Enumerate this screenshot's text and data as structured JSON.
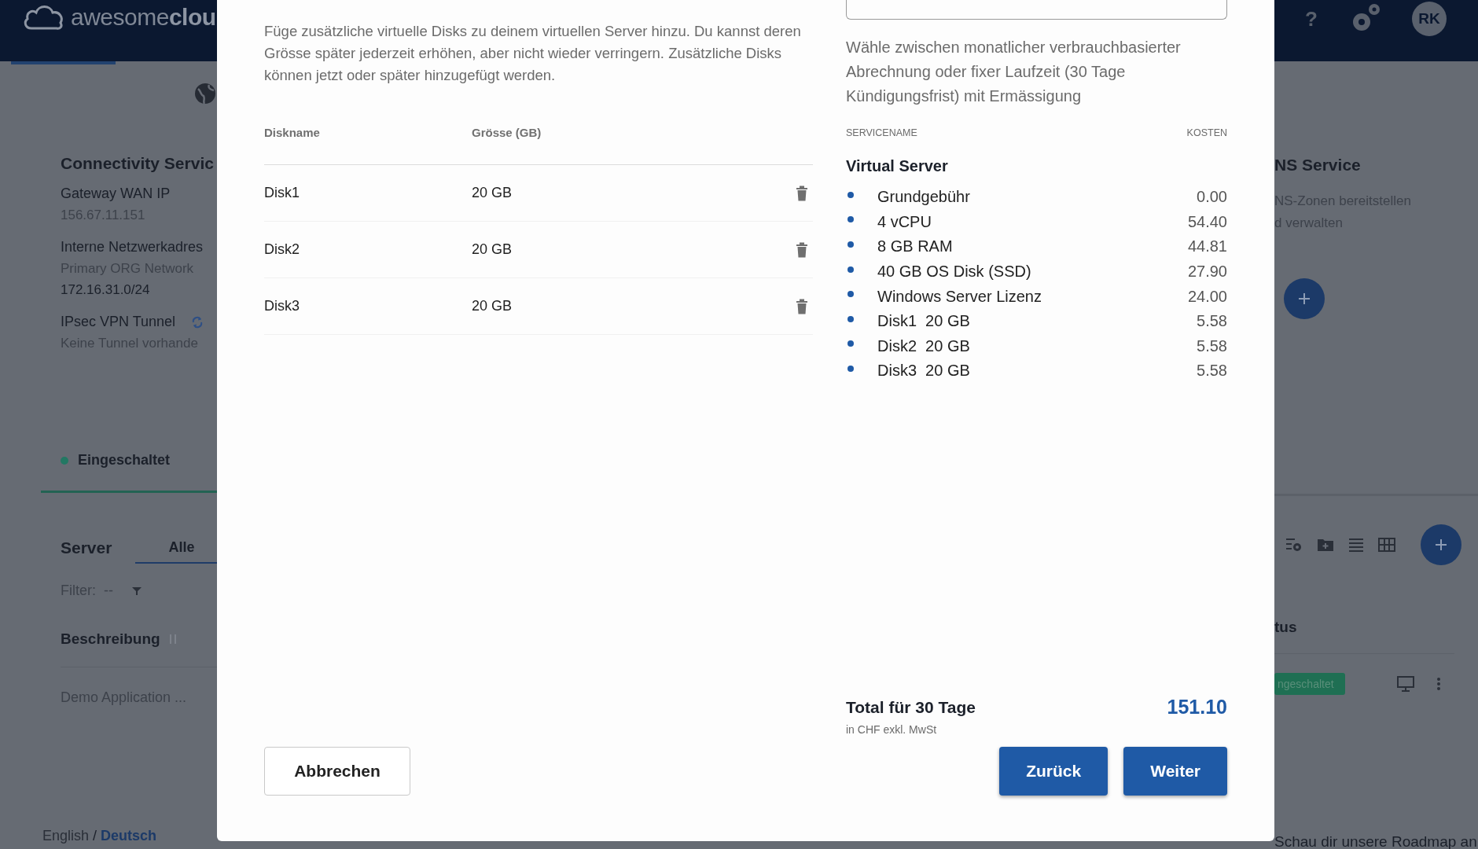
{
  "app_header": {
    "logo_text": "awesome**clou**",
    "help_label": "?",
    "avatar_initials": "RK"
  },
  "left_panel": {
    "connectivity_card": {
      "title": "Connectivity Servic",
      "fields": [
        {
          "label": "Gateway WAN IP",
          "kind": "plain",
          "lines": [
            {
              "text": "156.67.11.151",
              "kind": "muted"
            }
          ]
        },
        {
          "label": "Interne Netzwerkadres",
          "kind": "plain",
          "lines": [
            {
              "text": "Primary ORG Network",
              "kind": "muted"
            },
            {
              "text": "172.16.31.0/24",
              "kind": "strong"
            }
          ]
        },
        {
          "label": "IPsec VPN Tunnel",
          "kind": "sync",
          "lines": [
            {
              "text": "Keine Tunnel vorhande",
              "kind": "muted"
            }
          ]
        }
      ],
      "status": "Eingeschaltet"
    },
    "server_card": {
      "title": "Server",
      "tabs": [
        {
          "label": "Alle",
          "selected": true
        }
      ],
      "filter_label": "Filter:",
      "filter_value": "--",
      "column_header": "Beschreibung",
      "rows": [
        {
          "description": "Demo Application ..."
        }
      ]
    },
    "languages": [
      {
        "label": "English",
        "selected": false
      },
      {
        "label": "Deutsch",
        "selected": true
      }
    ],
    "language_separator": "/"
  },
  "right_panel": {
    "dns_card": {
      "title": "NS Service",
      "description_lines": [
        "NS-Zonen bereitstellen",
        "d verwalten"
      ]
    },
    "status_column_header": "tus",
    "row_status": "ngeschaltet",
    "footer_note": "Schau dir unsere Roadmap an"
  },
  "modal": {
    "left": {
      "description": "Füge zusätzliche virtuelle Disks zu deinem virtuellen Server hinzu. Du kannst deren Grösse später jederzeit erhöhen, aber nicht wieder verringern. Zusätzliche Disks können jetzt oder später hinzugefügt werden.",
      "disk_table": {
        "columns": [
          "Diskname",
          "Grösse (GB)"
        ],
        "rows": [
          {
            "name": "Disk1",
            "size": "20 GB"
          },
          {
            "name": "Disk2",
            "size": "20 GB"
          },
          {
            "name": "Disk3",
            "size": "20 GB"
          }
        ]
      },
      "cancel_button": "Abbrechen"
    },
    "right": {
      "billing_description": "Wähle zwischen monatlicher verbrauchbasierter Abrechnung oder fixer Laufzeit (30 Tage Kündigungsfrist) mit Ermässigung",
      "cost_table": {
        "columns": [
          "SERVICENAME",
          "KOSTEN"
        ],
        "group": "Virtual Server",
        "items": [
          {
            "name": "Grundgebühr",
            "cost": "0.00"
          },
          {
            "name": "4 vCPU",
            "cost": "54.40"
          },
          {
            "name": "8 GB RAM",
            "cost": "44.81"
          },
          {
            "name": "40 GB OS Disk (SSD)",
            "cost": "27.90"
          },
          {
            "name": "Windows Server Lizenz",
            "cost": "24.00"
          },
          {
            "name": "Disk1  20 GB",
            "cost": "5.58"
          },
          {
            "name": "Disk2  20 GB",
            "cost": "5.58"
          },
          {
            "name": "Disk3  20 GB",
            "cost": "5.58"
          }
        ]
      },
      "total_label": "Total für 30 Tage",
      "total_value": "151.10",
      "total_note": "in CHF exkl. MwSt",
      "buttons": [
        "Zurück",
        "Weiter"
      ]
    }
  }
}
